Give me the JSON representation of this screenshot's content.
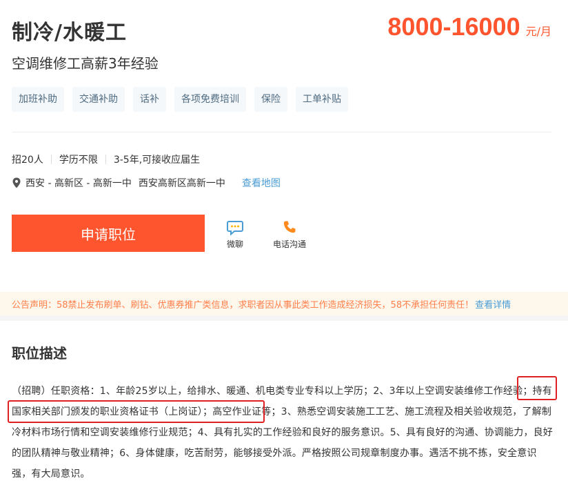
{
  "job": {
    "title": "制冷/水暖工",
    "salary": "8000-16000",
    "salary_unit": "元/月",
    "subtitle": "空调维修工高薪3年经验"
  },
  "tags": [
    "加班补助",
    "交通补助",
    "话补",
    "各项免费培训",
    "保险",
    "工单补贴"
  ],
  "meta": {
    "headcount": "招20人",
    "education": "学历不限",
    "experience": "3-5年,可接收应届生"
  },
  "location": {
    "area": "西安 - 高新区 - 高新一中",
    "address": "西安高新区高新一中",
    "map_link": "查看地图"
  },
  "actions": {
    "apply_label": "申请职位",
    "chat_label": "微聊",
    "phone_label": "电话沟通"
  },
  "notice": {
    "text": "公告声明：58禁止发布刷单、刷钻、优惠券推广类信息，求职者因从事此类工作造成经济损失，58不承担任何责任！",
    "more_link": "查看详情"
  },
  "description": {
    "heading": "职位描述",
    "body": "（招聘）任职资格：1、年龄25岁以上，给排水、暖通、机电类专业专科以上学历；2、3年以上空调安装维修工作经验；持有国家相关部门颁发的职业资格证书（上岗证）；高空作业证等；3、熟悉空调安装施工工艺、施工流程及相关验收规范，了解制冷材料市场行情和空调安装维修行业规范；4、具有扎实的工作经验和良好的服务意识。5、具有良好的沟通、协调能力，良好的团队精神与敬业精神；6、身体健康，吃苦耐劳，能够接受外派。严格按照公司规章制度办事。遇活不挑不拣，安全意识强，有大局意识。"
  },
  "colors": {
    "accent": "#ff552e",
    "link": "#4a9cd5",
    "tag_text": "#4f6b82",
    "notice_text": "#ff7f4a",
    "highlight": "#e02020"
  }
}
